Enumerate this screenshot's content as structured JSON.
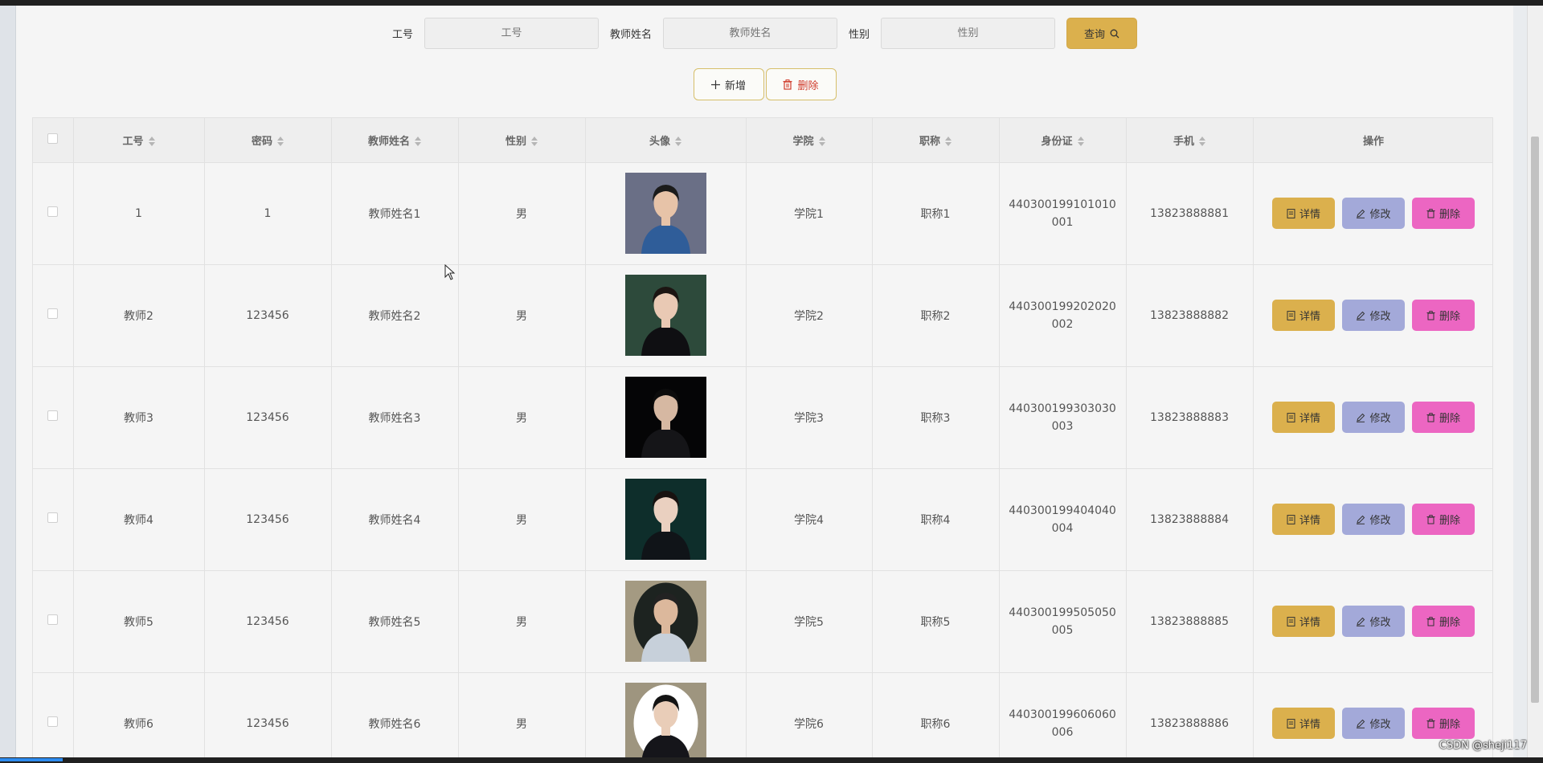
{
  "search": {
    "id_label": "工号",
    "id_placeholder": "工号",
    "name_label": "教师姓名",
    "name_placeholder": "教师姓名",
    "gender_label": "性别",
    "gender_placeholder": "性别",
    "query_label": "查询"
  },
  "actions": {
    "add_label": "新增",
    "delete_label": "删除"
  },
  "table": {
    "columns": [
      "工号",
      "密码",
      "教师姓名",
      "性别",
      "头像",
      "学院",
      "职称",
      "身份证",
      "手机",
      "操作"
    ],
    "rows": [
      {
        "id": "1",
        "password": "1",
        "name": "教师姓名1",
        "gender": "男",
        "college": "学院1",
        "title": "职称1",
        "idcard": "440300199101010001",
        "phone": "13823888881"
      },
      {
        "id": "教师2",
        "password": "123456",
        "name": "教师姓名2",
        "gender": "男",
        "college": "学院2",
        "title": "职称2",
        "idcard": "440300199202020002",
        "phone": "13823888882"
      },
      {
        "id": "教师3",
        "password": "123456",
        "name": "教师姓名3",
        "gender": "男",
        "college": "学院3",
        "title": "职称3",
        "idcard": "440300199303030003",
        "phone": "13823888883"
      },
      {
        "id": "教师4",
        "password": "123456",
        "name": "教师姓名4",
        "gender": "男",
        "college": "学院4",
        "title": "职称4",
        "idcard": "440300199404040004",
        "phone": "13823888884"
      },
      {
        "id": "教师5",
        "password": "123456",
        "name": "教师姓名5",
        "gender": "男",
        "college": "学院5",
        "title": "职称5",
        "idcard": "440300199505050005",
        "phone": "13823888885"
      },
      {
        "id": "教师6",
        "password": "123456",
        "name": "教师姓名6",
        "gender": "男",
        "college": "学院6",
        "title": "职称6",
        "idcard": "440300199606060006",
        "phone": "13823888886"
      }
    ],
    "op_labels": {
      "detail": "详情",
      "edit": "修改",
      "delete": "删除"
    }
  },
  "watermark": "CSDN @sheji117",
  "colors": {
    "query": "#dbb04d",
    "detail": "#dbb04d",
    "edit": "#a3a9d9",
    "delete": "#ec66c2",
    "danger_text": "#d03c2c"
  }
}
